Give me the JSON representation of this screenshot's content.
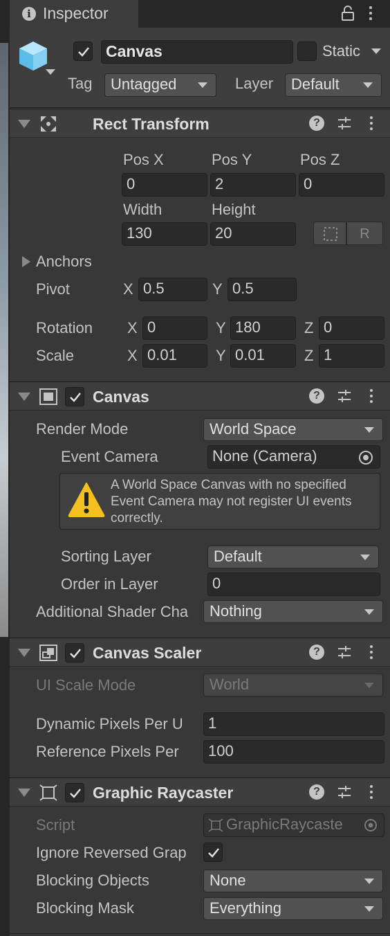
{
  "tab": {
    "title": "Inspector"
  },
  "header": {
    "object_name": "Canvas",
    "static_label": "Static",
    "tag_label": "Tag",
    "tag_value": "Untagged",
    "layer_label": "Layer",
    "layer_value": "Default"
  },
  "rect_transform": {
    "title": "Rect Transform",
    "pos_x_label": "Pos X",
    "pos_y_label": "Pos Y",
    "pos_z_label": "Pos Z",
    "pos_x": "0",
    "pos_y": "2",
    "pos_z": "0",
    "width_label": "Width",
    "height_label": "Height",
    "width": "130",
    "height": "20",
    "r_button": "R",
    "anchors_label": "Anchors",
    "pivot_label": "Pivot",
    "pivot_x": "0.5",
    "pivot_y": "0.5",
    "rotation_label": "Rotation",
    "rot_x": "0",
    "rot_y": "180",
    "rot_z": "0",
    "scale_label": "Scale",
    "scale_x": "0.01",
    "scale_y": "0.01",
    "scale_z": "1",
    "x": "X",
    "y": "Y",
    "z": "Z"
  },
  "canvas": {
    "title": "Canvas",
    "render_mode_label": "Render Mode",
    "render_mode": "World Space",
    "event_camera_label": "Event Camera",
    "event_camera": "None (Camera)",
    "warning": "A World Space Canvas with no specified Event Camera may not register UI events correctly.",
    "sorting_layer_label": "Sorting Layer",
    "sorting_layer": "Default",
    "order_label": "Order in Layer",
    "order": "0",
    "shader_label": "Additional Shader Chа",
    "shader_value": "Nothing"
  },
  "canvas_scaler": {
    "title": "Canvas Scaler",
    "ui_scale_label": "UI Scale Mode",
    "ui_scale_value": "World",
    "dynamic_label": "Dynamic Pixels Per U",
    "dynamic_value": "1",
    "reference_label": "Reference Pixels Per",
    "reference_value": "100"
  },
  "graphic_raycaster": {
    "title": "Graphic Raycaster",
    "script_label": "Script",
    "script_value": "GraphicRaycaste",
    "ignore_label": "Ignore Reversed Grap",
    "blocking_objects_label": "Blocking Objects",
    "blocking_objects": "None",
    "blocking_mask_label": "Blocking Mask",
    "blocking_mask": "Everything"
  }
}
